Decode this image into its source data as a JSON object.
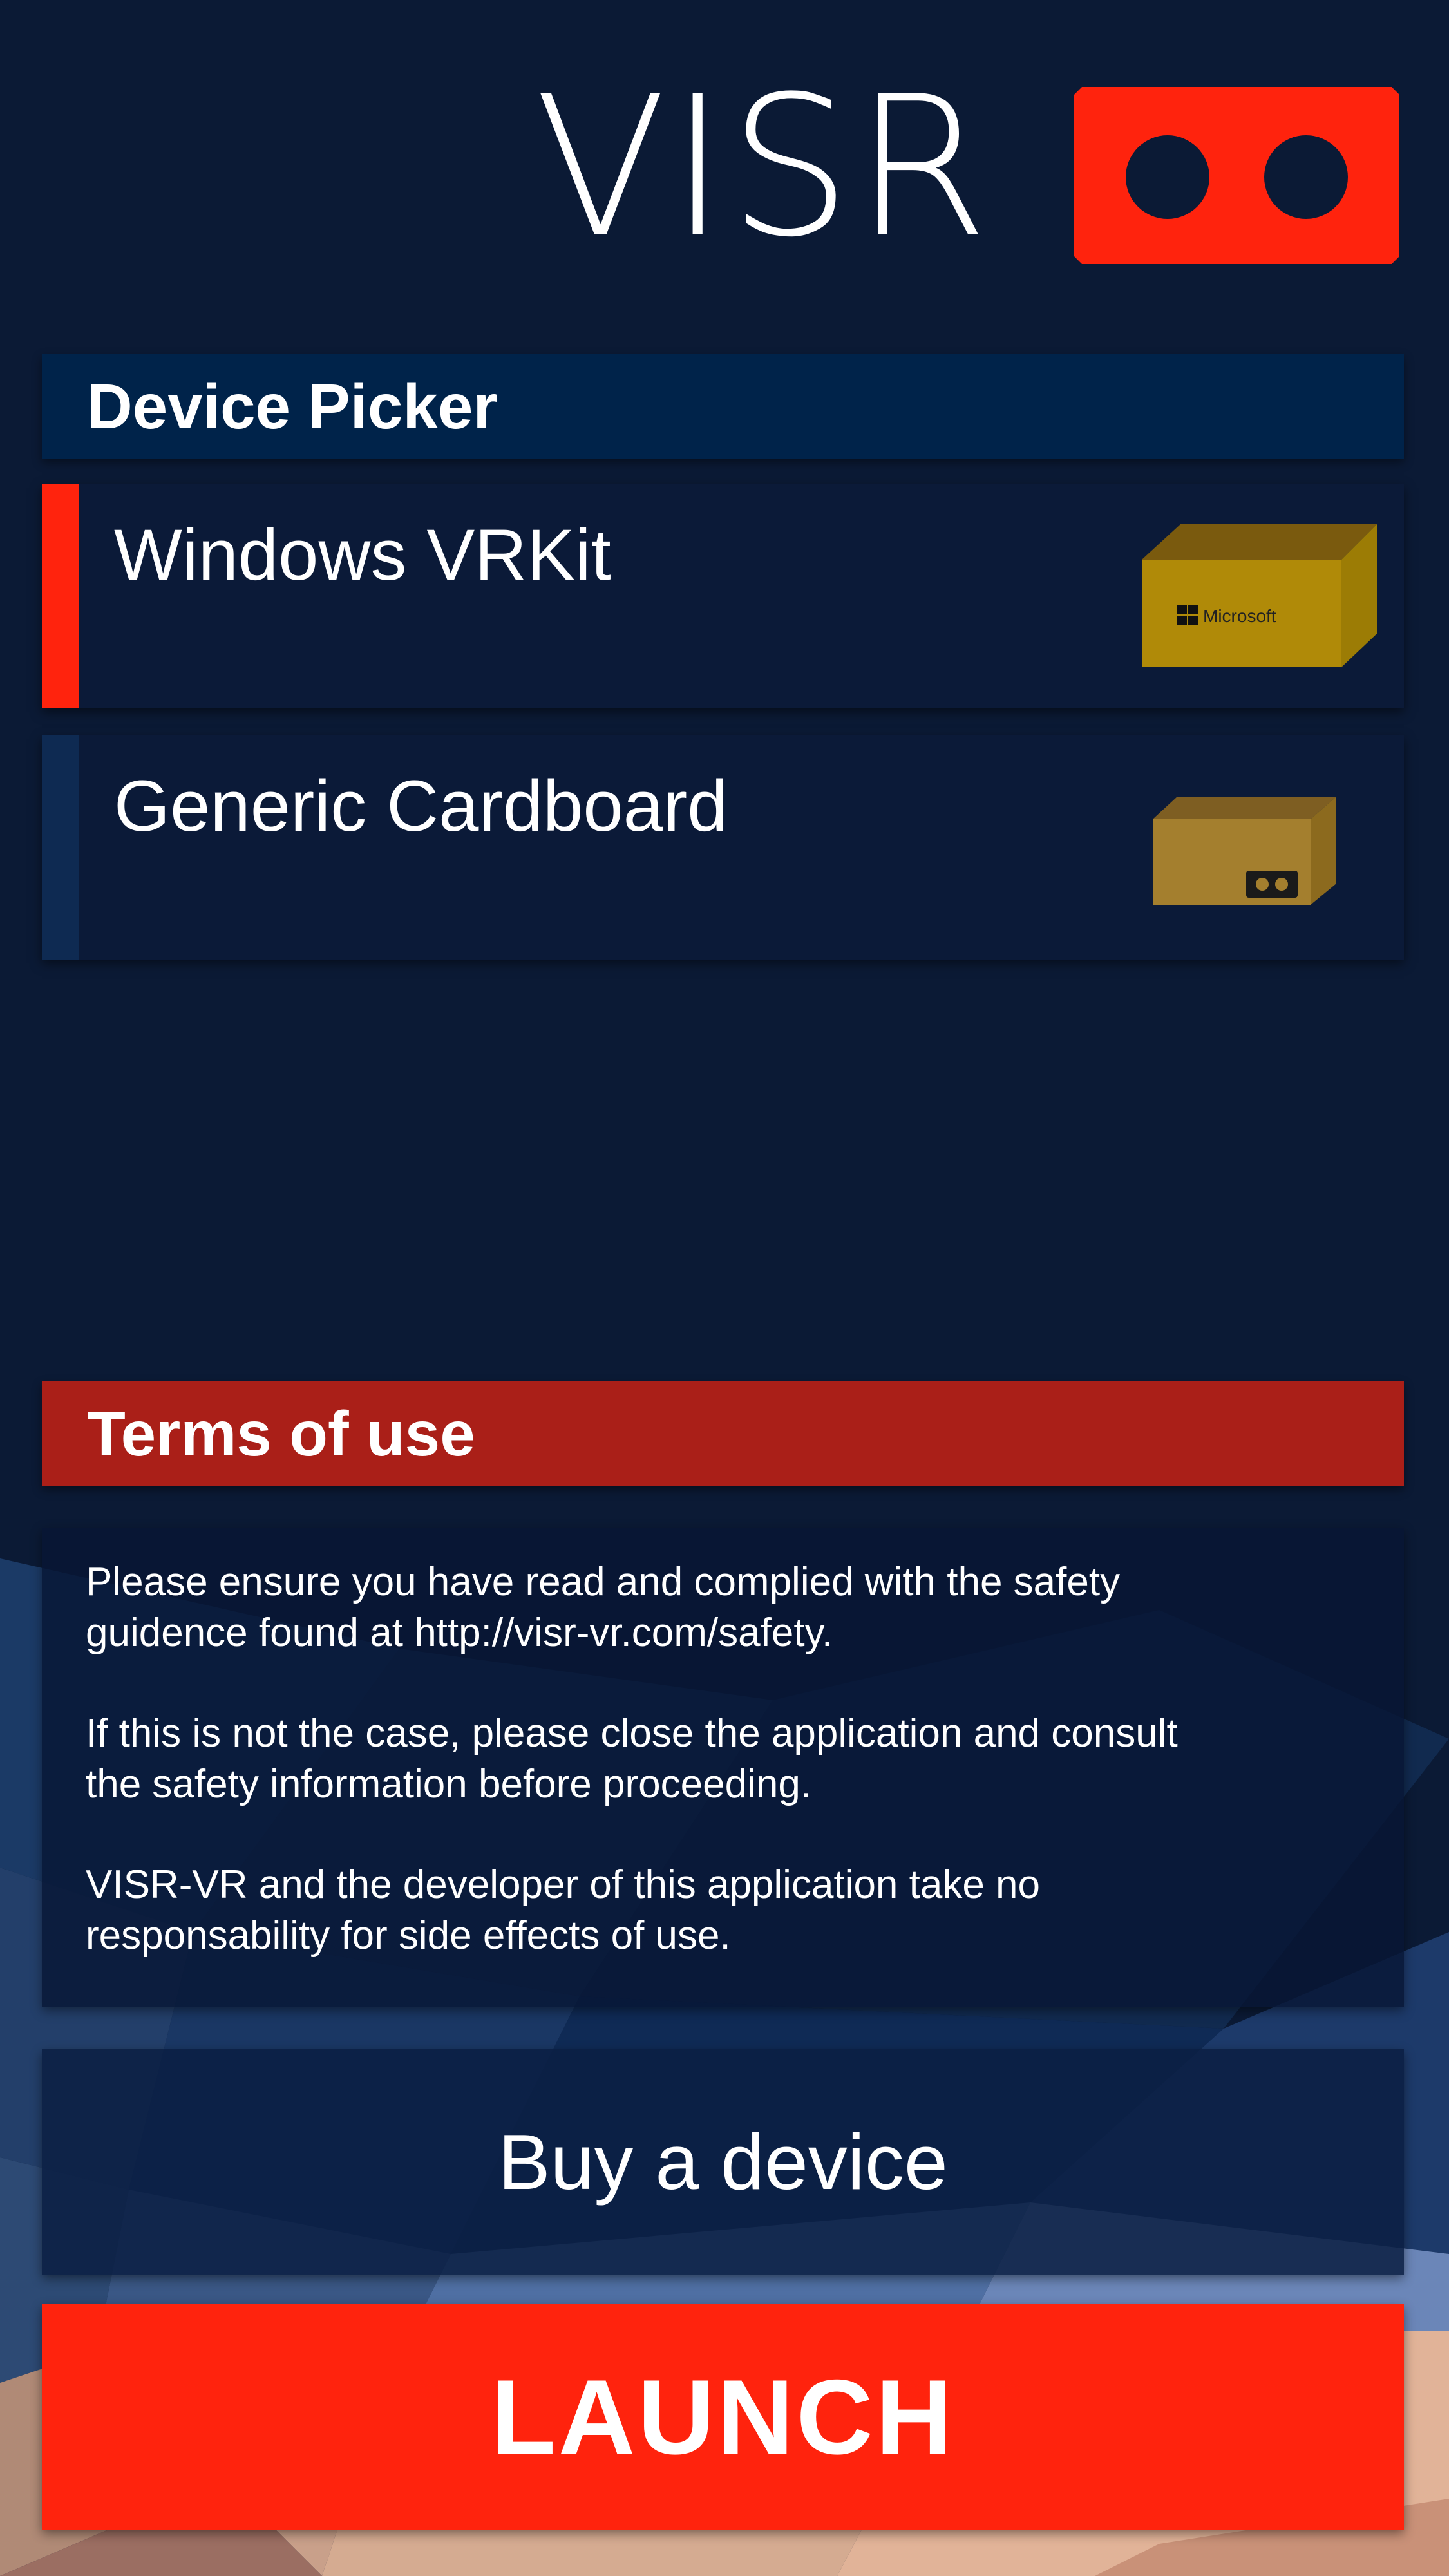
{
  "app": {
    "logo_text": "VISR",
    "logo_icon": "vr-headset-icon"
  },
  "device_picker": {
    "title": "Device Picker",
    "items": [
      {
        "label": "Windows VRKit",
        "selected": true,
        "image_icon": "microsoft-box-icon",
        "box_text": "Microsoft"
      },
      {
        "label": "Generic Cardboard",
        "selected": false,
        "image_icon": "cardboard-box-icon"
      }
    ]
  },
  "terms": {
    "title": "Terms of use",
    "paragraphs": [
      "Please ensure you have read and complied with the safety\nguidence found at http://visr-vr.com/safety.",
      "If this is not the case, please close the application and consult\nthe safety information before proceeding.",
      "VISR-VR and the developer of this application take no\nresponsability for side effects of use."
    ]
  },
  "actions": {
    "buy_label": "Buy a device",
    "launch_label": "LAUNCH"
  },
  "colors": {
    "background": "#0b1a35",
    "accent_red": "#ff230d",
    "header_blue": "#00234a",
    "terms_header_red": "#aa1f18",
    "item_bg": "#0b1a38",
    "unselected_accent": "#0e2a52"
  }
}
